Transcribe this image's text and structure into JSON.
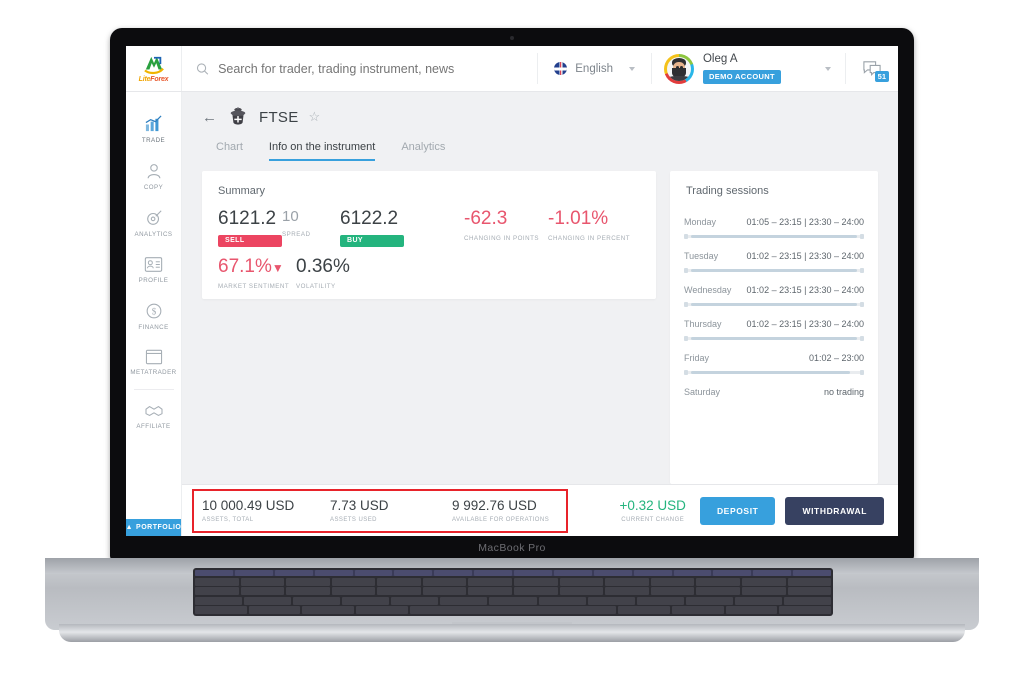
{
  "mockup": {
    "device_label": "MacBook Pro"
  },
  "brand": {
    "name_lite": "Lite",
    "name_forex": "Forex",
    "mark": "liteforex-logo"
  },
  "search": {
    "placeholder": "Search for trader, trading instrument, news",
    "value": "",
    "icon": "search-icon"
  },
  "language": {
    "label": "English",
    "flag": "uk-flag-icon",
    "chevron": "chevron-down-icon"
  },
  "account": {
    "name": "Oleg A",
    "badge": "DEMO ACCOUNT",
    "avatar": "user-avatar",
    "chevron": "chevron-down-icon"
  },
  "messages": {
    "icon": "chat-bubbles-icon",
    "count": "51"
  },
  "sidebar": {
    "items": [
      {
        "label": "TRADE",
        "icon": "chart-bars-icon",
        "active": true
      },
      {
        "label": "COPY",
        "icon": "copy-trader-icon",
        "active": false
      },
      {
        "label": "ANALYTICS",
        "icon": "analytics-target-icon",
        "active": false
      },
      {
        "label": "PROFILE",
        "icon": "id-card-icon",
        "active": false
      },
      {
        "label": "FINANCE",
        "icon": "dollar-coin-icon",
        "active": false
      },
      {
        "label": "METATRADER",
        "icon": "window-icon",
        "active": false
      },
      {
        "label": "AFFILIATE",
        "icon": "handshake-icon",
        "active": false
      }
    ],
    "portfolio": {
      "label": "PORTFOLIO",
      "caret": "chevron-up-icon"
    }
  },
  "instrument": {
    "back": "back-arrow-icon",
    "emblem": "uk-coat-of-arms-icon",
    "name": "FTSE",
    "favorite": "star-icon"
  },
  "tabs": [
    {
      "label": "Chart",
      "active": false
    },
    {
      "label": "Info on the instrument",
      "active": true
    },
    {
      "label": "Analytics",
      "active": false
    }
  ],
  "summary": {
    "title": "Summary",
    "sell": {
      "value": "6121.2",
      "pill": "SELL"
    },
    "spread": {
      "value": "10",
      "caption": "SPREAD"
    },
    "buy": {
      "value": "6122.2",
      "pill": "BUY"
    },
    "change_points": {
      "value": "-62.3",
      "caption": "CHANGING IN POINTS"
    },
    "change_percent": {
      "value": "-1.01%",
      "caption": "CHANGING IN PERCENT"
    },
    "market_sentiment": {
      "value": "67.1%",
      "arrow": "▼",
      "caption": "MARKET SENTIMENT"
    },
    "volatility": {
      "value": "0.36%",
      "caption": "VOLATILITY"
    }
  },
  "sessions": {
    "title": "Trading sessions",
    "rows": [
      {
        "day": "Monday",
        "time": "01:05 – 23:15 | 23:30 – 24:00",
        "fill_start": 4,
        "fill_width": 92
      },
      {
        "day": "Tuesday",
        "time": "01:02 – 23:15 | 23:30 – 24:00",
        "fill_start": 4,
        "fill_width": 92
      },
      {
        "day": "Wednesday",
        "time": "01:02 – 23:15 | 23:30 – 24:00",
        "fill_start": 4,
        "fill_width": 92
      },
      {
        "day": "Thursday",
        "time": "01:02 – 23:15 | 23:30 – 24:00",
        "fill_start": 4,
        "fill_width": 92
      },
      {
        "day": "Friday",
        "time": "01:02 – 23:00",
        "fill_start": 4,
        "fill_width": 88
      },
      {
        "day": "Saturday",
        "time": "no trading",
        "fill_start": 0,
        "fill_width": 0
      }
    ]
  },
  "portfolio_bar": {
    "total": {
      "value": "10 000.49 USD",
      "caption": "ASSETS, TOTAL"
    },
    "used": {
      "value": "7.73 USD",
      "caption": "ASSETS USED"
    },
    "available": {
      "value": "9 992.76 USD",
      "caption": "AVAILABLE FOR OPERATIONS"
    },
    "current_change": {
      "value": "+0.32 USD",
      "caption": "CURRENT CHANGE"
    },
    "deposit_label": "DEPOSIT",
    "withdrawal_label": "WITHDRAWAL"
  },
  "colors": {
    "accent_blue": "#37a0dd",
    "sell_red": "#ec4561",
    "buy_green": "#24b47e",
    "navy": "#374161",
    "highlight_red": "#e8232a",
    "negative": "#e8566e"
  }
}
